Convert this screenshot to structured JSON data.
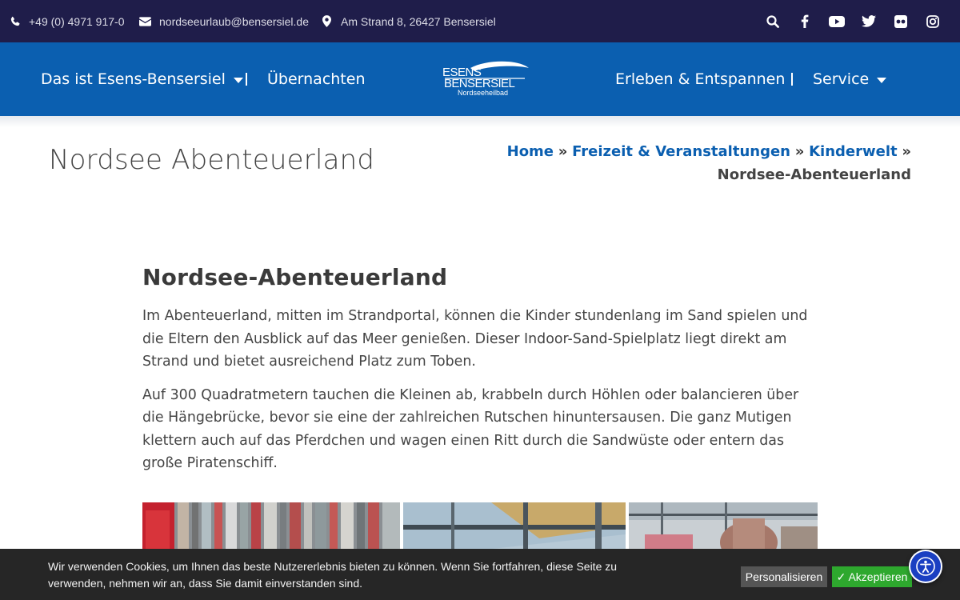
{
  "topbar": {
    "phone": "+49 (0) 4971 917-0",
    "email": "nordseeurlaub@bensersiel.de",
    "address": "Am Strand 8, 26427 Bensersiel",
    "social_icons": [
      "search-icon",
      "facebook-icon",
      "youtube-icon",
      "twitter-icon",
      "flickr-icon",
      "instagram-icon"
    ]
  },
  "nav": {
    "items": [
      {
        "label": "Das ist Esens-Bensersiel",
        "dropdown": true
      },
      {
        "label": "Übernachten",
        "dropdown": false
      },
      {
        "label": "Erleben & Entspannen",
        "dropdown": false
      },
      {
        "label": "Service",
        "dropdown": true
      }
    ],
    "logo": {
      "line1": "ESENS",
      "line2": "BENSERSIEL",
      "line3": "Nordseeheilbad"
    }
  },
  "page": {
    "title": "Nordsee Abenteuerland",
    "breadcrumb": {
      "links": [
        "Home",
        "Freizeit & Veranstaltungen",
        "Kinderwelt"
      ],
      "separator": "»",
      "current": "Nordsee-Abenteuerland"
    }
  },
  "article": {
    "heading": "Nordsee-Abenteuerland",
    "paragraphs": [
      "Im Abenteuerland, mitten im Strandportal, können die Kinder stundenlang im Sand spielen und die Eltern den Ausblick auf das Meer genießen. Dieser Indoor-Sand-Spielplatz liegt direkt am Strand und bietet ausreichend Platz zum Toben.",
      "Auf 300 Quadratmetern tauchen die Kleinen ab, krabbeln durch Höhlen oder balancieren über die Hängebrücke, bevor sie eine der zahlreichen Rutschen hinuntersausen. Die ganz Mutigen klettern auch auf das Pferdchen und wagen einen Ritt durch die Sandwüste oder entern das große Piratenschiff."
    ]
  },
  "cookie": {
    "text": "Wir verwenden Cookies, um Ihnen das beste Nutzererlebnis bieten zu können. Wenn Sie fortfahren, diese Seite zu verwenden, nehmen wir an, dass Sie damit einverstanden sind.",
    "personalize_label": "Personalisieren",
    "accept_label": "✓ Akzeptieren"
  },
  "colors": {
    "topbar_bg": "#1f1d4a",
    "nav_bg": "#0b5fb0",
    "link": "#0b5fb0",
    "cookie_bg": "#262626",
    "accept_green": "#2ea82e",
    "a11y_blue": "#1a3fc2"
  }
}
